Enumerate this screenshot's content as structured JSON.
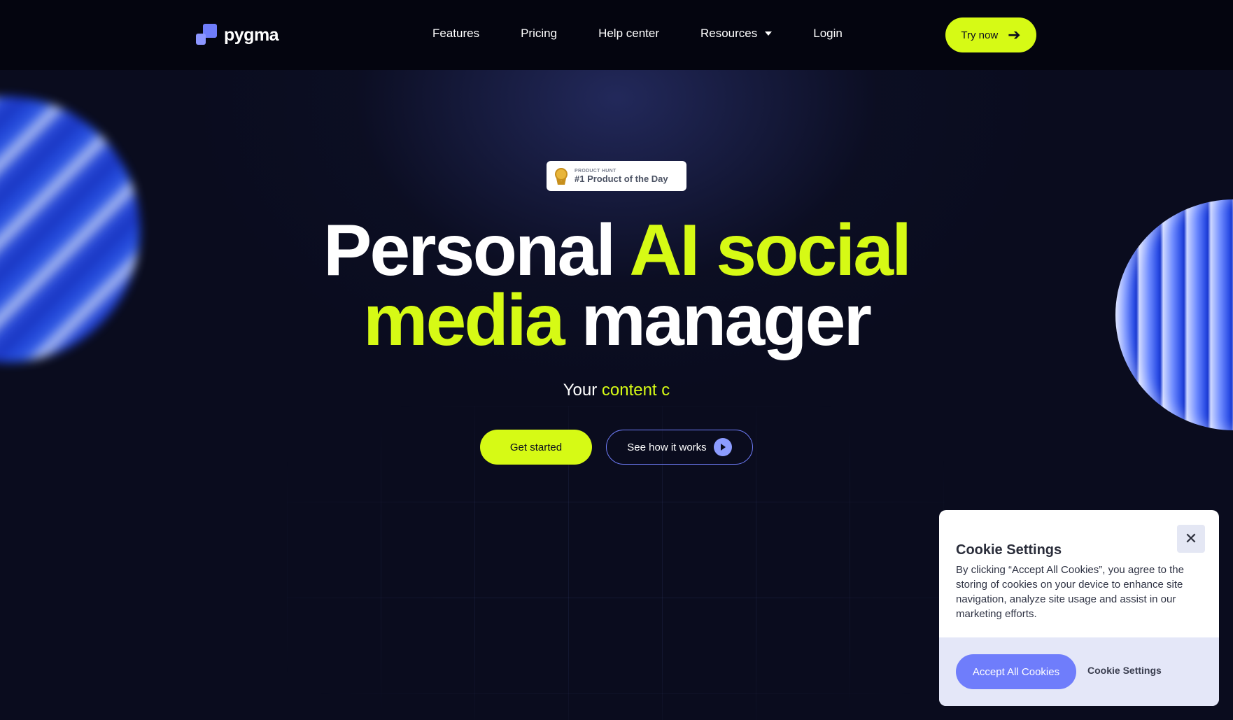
{
  "nav": {
    "logo_text": "pygma",
    "links": [
      {
        "label": "Features"
      },
      {
        "label": "Pricing"
      },
      {
        "label": "Help center"
      },
      {
        "label": "Resources"
      },
      {
        "label": "Login"
      }
    ],
    "cta_label": "Try now"
  },
  "badge": {
    "small_label": "PRODUCT HUNT",
    "title": "#1 Product of the Day"
  },
  "hero": {
    "headline_white_1": "Personal ",
    "headline_lime_1": "AI social",
    "headline_lime_2": "media",
    "headline_white_2": " manager",
    "sub_white": "Your ",
    "sub_lime": "content c",
    "primary_cta": "Get started",
    "secondary_cta": "See how it works"
  },
  "cookie": {
    "title": "Cookie Settings",
    "body": "By clicking “Accept All Cookies”, you agree to the storing of cookies on your device to enhance site navigation, analyze site usage and assist in our marketing efforts.",
    "close_symbol": "✕",
    "accept_label": "Accept All Cookies",
    "settings_label": "Cookie Settings"
  },
  "colors": {
    "background": "#0a0c1e",
    "accent_lime": "#d6fa15",
    "accent_blue": "#6f7dfb"
  },
  "icons": {
    "logo": "pygma-logo-icon",
    "resources_dropdown": "chevron-down-icon",
    "try_now_arrow": "arrow-right-icon",
    "badge_medal": "medal-icon",
    "play": "play-icon",
    "cookie_close": "close-icon"
  }
}
